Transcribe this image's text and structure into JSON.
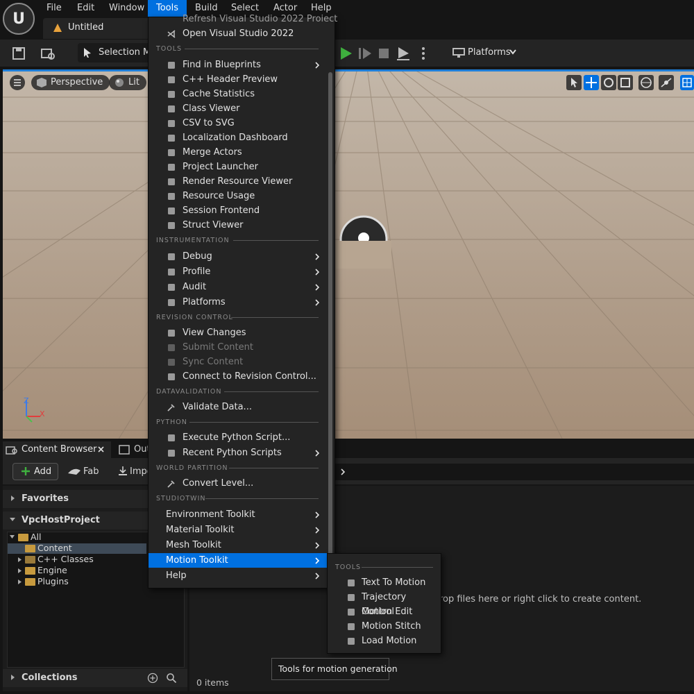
{
  "menubar": {
    "items": [
      "File",
      "Edit",
      "Window",
      "Tools",
      "Build",
      "Select",
      "Actor",
      "Help"
    ],
    "active": "Tools"
  },
  "tab": {
    "title": "Untitled"
  },
  "toolbar": {
    "selection_mode": "Selection Mo",
    "platforms": "Platforms"
  },
  "viewport": {
    "view_mode": "Perspective",
    "lighting": "Lit",
    "axis_labels": {
      "z": "Z",
      "x": "X"
    }
  },
  "tools_menu": {
    "top_partial": "Refresh Visual Studio 2022 Project",
    "open_vs": "Open Visual Studio 2022",
    "sections": {
      "tools": "TOOLS",
      "instrumentation": "INSTRUMENTATION",
      "revision_control": "REVISION CONTROL",
      "datavalidation": "DATAVALIDATION",
      "python": "PYTHON",
      "world_partition": "WORLD PARTITION",
      "studiotwin": "STUDIOTWIN"
    },
    "tools_items": [
      {
        "label": "Find in Blueprints",
        "icon": "find-icon",
        "submenu": true
      },
      {
        "label": "C++ Header Preview",
        "icon": "header-icon",
        "submenu": false
      },
      {
        "label": "Cache Statistics",
        "icon": "stats-icon",
        "submenu": false
      },
      {
        "label": "Class Viewer",
        "icon": "class-icon",
        "submenu": false
      },
      {
        "label": "CSV to SVG",
        "icon": "csv-icon",
        "submenu": false
      },
      {
        "label": "Localization Dashboard",
        "icon": "flag-icon",
        "submenu": false
      },
      {
        "label": "Merge Actors",
        "icon": "merge-icon",
        "submenu": false
      },
      {
        "label": "Project Launcher",
        "icon": "launcher-icon",
        "submenu": false
      },
      {
        "label": "Render Resource Viewer",
        "icon": "render-icon",
        "submenu": false
      },
      {
        "label": "Resource Usage",
        "icon": "table-icon",
        "submenu": false
      },
      {
        "label": "Session Frontend",
        "icon": "session-icon",
        "submenu": false
      },
      {
        "label": "Struct Viewer",
        "icon": "struct-icon",
        "submenu": false
      }
    ],
    "instrumentation_items": [
      {
        "label": "Debug",
        "icon": "bug-icon"
      },
      {
        "label": "Profile",
        "icon": "profile-icon"
      },
      {
        "label": "Audit",
        "icon": "audit-icon"
      },
      {
        "label": "Platforms",
        "icon": "platforms-icon"
      }
    ],
    "revision_items": [
      {
        "label": "View Changes",
        "icon": "check-icon",
        "disabled": false
      },
      {
        "label": "Submit Content",
        "icon": "arrow-left-icon",
        "disabled": true
      },
      {
        "label": "Sync Content",
        "icon": "arrow-right-icon",
        "disabled": true
      },
      {
        "label": "Connect to Revision Control...",
        "icon": "branch-icon",
        "disabled": false
      }
    ],
    "validate": "Validate Data...",
    "python_items": [
      {
        "label": "Execute Python Script...",
        "submenu": false
      },
      {
        "label": "Recent Python Scripts",
        "submenu": true
      }
    ],
    "convert_level": "Convert Level...",
    "studiotwin_items": [
      "Environment Toolkit",
      "Material Toolkit",
      "Mesh Toolkit",
      "Motion Toolkit",
      "Help"
    ],
    "highlighted": "Motion Toolkit"
  },
  "submenu": {
    "section": "TOOLS",
    "items": [
      "Text To Motion",
      "Trajectory Control",
      "Motion Edit",
      "Motion Stitch",
      "Load Motion"
    ]
  },
  "tooltip": "Tools for motion generation",
  "content_browser": {
    "tab_label": "Content Browser",
    "second_tab": "Out",
    "add": "Add",
    "fab": "Fab",
    "import": "Impo",
    "favorites": "Favorites",
    "project": "VpcHostProject",
    "tree": [
      "All",
      "Content",
      "C++ Classes",
      "Engine",
      "Plugins"
    ],
    "collections": "Collections",
    "drop_hint": "rop files here or right click to create content.",
    "item_count": "0 items"
  },
  "colors": {
    "accent": "#0070e0",
    "menu_bg": "#242424",
    "play_green": "#3fb13f"
  }
}
